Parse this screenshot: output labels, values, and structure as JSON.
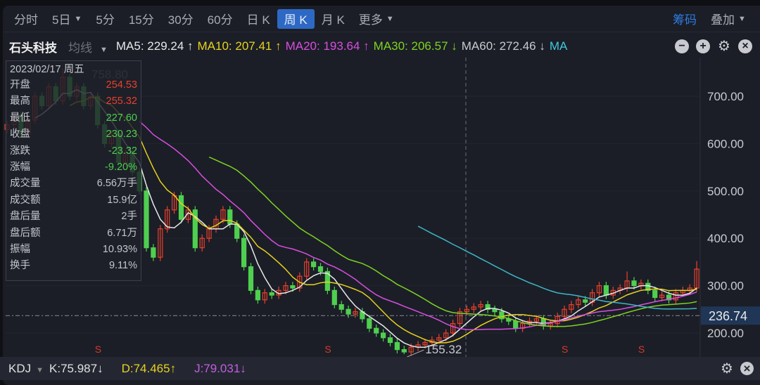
{
  "toolbar": {
    "periods": [
      "分时",
      "5日",
      "5分",
      "15分",
      "30分",
      "60分",
      "日 K",
      "周 K",
      "月 K",
      "更多"
    ],
    "active": "周 K",
    "right": {
      "chips": "筹码",
      "overlay": "叠加"
    }
  },
  "legend": {
    "stock_name": "石头科技",
    "ma_mode": "均线",
    "ma5": "MA5: 229.24 ↑",
    "ma10": "MA10: 207.41 ↑",
    "ma20": "MA20: 193.64 ↑",
    "ma30": "MA30: 206.57 ↓",
    "ma60": "MA60: 272.46 ↓",
    "ma": "MA"
  },
  "colors": {
    "ma5": "#e8e8e8",
    "ma10": "#e6d21e",
    "ma20": "#d94ee0",
    "ma30": "#7ed321",
    "ma60": "#3fb6c6",
    "up": "#e8402c",
    "down": "#4fcf4f",
    "accent": "#2d69c4"
  },
  "tooltip": {
    "date": "2023/02/17 周五",
    "rows": [
      {
        "label": "开盘",
        "value": "254.53",
        "color": "#e8402c"
      },
      {
        "label": "最高",
        "value": "255.32",
        "color": "#e8402c"
      },
      {
        "label": "最低",
        "value": "227.60",
        "color": "#4fcf4f"
      },
      {
        "label": "收盘",
        "value": "230.23",
        "color": "#4fcf4f"
      },
      {
        "label": "涨跌",
        "value": "-23.32",
        "color": "#4fcf4f"
      },
      {
        "label": "涨幅",
        "value": "-9.20%",
        "color": "#4fcf4f"
      },
      {
        "label": "成交量",
        "value": "6.56万手",
        "color": "#c4c6cc"
      },
      {
        "label": "成交额",
        "value": "15.9亿",
        "color": "#c4c6cc"
      },
      {
        "label": "盘后量",
        "value": "2手",
        "color": "#c4c6cc"
      },
      {
        "label": "盘后额",
        "value": "6.71万",
        "color": "#c4c6cc"
      },
      {
        "label": "振幅",
        "value": "10.93%",
        "color": "#c4c6cc"
      },
      {
        "label": "换手",
        "value": "9.11%",
        "color": "#c4c6cc"
      }
    ]
  },
  "chart_data": {
    "type": "candlestick",
    "y_ticks": [
      "700.00",
      "600.00",
      "500.00",
      "400.00",
      "300.00",
      "200.00"
    ],
    "y_tick_values": [
      700,
      600,
      500,
      400,
      300,
      200
    ],
    "max_label": "758.80",
    "max_value": 758.8,
    "min_label": "155.32",
    "min_value": 155.32,
    "crosshair_label": "236.74",
    "crosshair_value": 236.74,
    "signal_label": "S",
    "signal_candles": [
      13,
      46,
      80,
      91
    ],
    "ohlc": [
      [
        630,
        648,
        622,
        640
      ],
      [
        640,
        668,
        632,
        660
      ],
      [
        660,
        668,
        612,
        620
      ],
      [
        620,
        658,
        612,
        650
      ],
      [
        650,
        708,
        642,
        700
      ],
      [
        700,
        708,
        672,
        680
      ],
      [
        680,
        728,
        672,
        720
      ],
      [
        720,
        728,
        682,
        690
      ],
      [
        690,
        758.8,
        682,
        740
      ],
      [
        740,
        748,
        692,
        700
      ],
      [
        700,
        728,
        692,
        720
      ],
      [
        720,
        728,
        672,
        680
      ],
      [
        680,
        708,
        672,
        700
      ],
      [
        700,
        708,
        632,
        640
      ],
      [
        640,
        648,
        592,
        600
      ],
      [
        600,
        628,
        592,
        620
      ],
      [
        620,
        628,
        552,
        560
      ],
      [
        560,
        588,
        552,
        580
      ],
      [
        580,
        588,
        532,
        540
      ],
      [
        540,
        548,
        492,
        500
      ],
      [
        500,
        508,
        372,
        380
      ],
      [
        380,
        388,
        352,
        360
      ],
      [
        360,
        428,
        352,
        420
      ],
      [
        420,
        468,
        412,
        460
      ],
      [
        460,
        498,
        452,
        490
      ],
      [
        490,
        498,
        432,
        440
      ],
      [
        440,
        468,
        432,
        460
      ],
      [
        460,
        468,
        372,
        380
      ],
      [
        380,
        408,
        372,
        400
      ],
      [
        400,
        428,
        392,
        420
      ],
      [
        420,
        448,
        412,
        440
      ],
      [
        440,
        468,
        432,
        460
      ],
      [
        460,
        468,
        422,
        430
      ],
      [
        430,
        438,
        392,
        400
      ],
      [
        400,
        408,
        332,
        340
      ],
      [
        340,
        348,
        282,
        290
      ],
      [
        290,
        298,
        262,
        270
      ],
      [
        270,
        293,
        262,
        285
      ],
      [
        285,
        293,
        272,
        280
      ],
      [
        280,
        298,
        272,
        290
      ],
      [
        290,
        308,
        282,
        300
      ],
      [
        300,
        308,
        287,
        295
      ],
      [
        295,
        328,
        287,
        320
      ],
      [
        320,
        358,
        312,
        350
      ],
      [
        350,
        358,
        332,
        340
      ],
      [
        340,
        348,
        322,
        330
      ],
      [
        330,
        338,
        282,
        290
      ],
      [
        290,
        298,
        252,
        260
      ],
      [
        260,
        268,
        242,
        250
      ],
      [
        250,
        258,
        232,
        240
      ],
      [
        240,
        253,
        232,
        245
      ],
      [
        245,
        253,
        222,
        230
      ],
      [
        230,
        238,
        202,
        210
      ],
      [
        210,
        218,
        192,
        200
      ],
      [
        200,
        208,
        182,
        190
      ],
      [
        190,
        198,
        172,
        180
      ],
      [
        180,
        188,
        157,
        165
      ],
      [
        165,
        173,
        155.32,
        160
      ],
      [
        160,
        178,
        152,
        170
      ],
      [
        170,
        183,
        162,
        175
      ],
      [
        175,
        188,
        167,
        180
      ],
      [
        180,
        193,
        172,
        185
      ],
      [
        185,
        198,
        177,
        190
      ],
      [
        190,
        208,
        182,
        200
      ],
      [
        200,
        228,
        192,
        220
      ],
      [
        220,
        253,
        212,
        245
      ],
      [
        245,
        258,
        237,
        250
      ],
      [
        250,
        263,
        242,
        255
      ],
      [
        255,
        268,
        247,
        260
      ],
      [
        260,
        268,
        242,
        250
      ],
      [
        250,
        258,
        237,
        245
      ],
      [
        245,
        253,
        222,
        230
      ],
      [
        230,
        238,
        217,
        225
      ],
      [
        225,
        233,
        202,
        210
      ],
      [
        210,
        228,
        202,
        220
      ],
      [
        220,
        233,
        212,
        225
      ],
      [
        225,
        238,
        217,
        230
      ],
      [
        230,
        238,
        207,
        215
      ],
      [
        215,
        228,
        207,
        220
      ],
      [
        220,
        243,
        212,
        235
      ],
      [
        235,
        258,
        227,
        250
      ],
      [
        250,
        268,
        242,
        260
      ],
      [
        260,
        278,
        252,
        270
      ],
      [
        270,
        278,
        257,
        265
      ],
      [
        265,
        293,
        257,
        285
      ],
      [
        285,
        308,
        277,
        300
      ],
      [
        300,
        308,
        272,
        280
      ],
      [
        280,
        298,
        272,
        290
      ],
      [
        290,
        303,
        282,
        295
      ],
      [
        295,
        330,
        287,
        310
      ],
      [
        310,
        318,
        292,
        300
      ],
      [
        300,
        313,
        292,
        305
      ],
      [
        305,
        313,
        282,
        290
      ],
      [
        290,
        298,
        267,
        275
      ],
      [
        275,
        288,
        267,
        280
      ],
      [
        280,
        288,
        262,
        270
      ],
      [
        270,
        293,
        262,
        285
      ],
      [
        285,
        298,
        277,
        290
      ],
      [
        290,
        303,
        282,
        295
      ],
      [
        295,
        352,
        287,
        335
      ]
    ]
  },
  "kdj": {
    "name": "KDJ",
    "k": "K:75.987↓",
    "d": "D:74.465↑",
    "j": "J:79.031↓",
    "k_color": "#e0e0e0",
    "d_color": "#e6d21e",
    "j_color": "#c55ee0"
  }
}
